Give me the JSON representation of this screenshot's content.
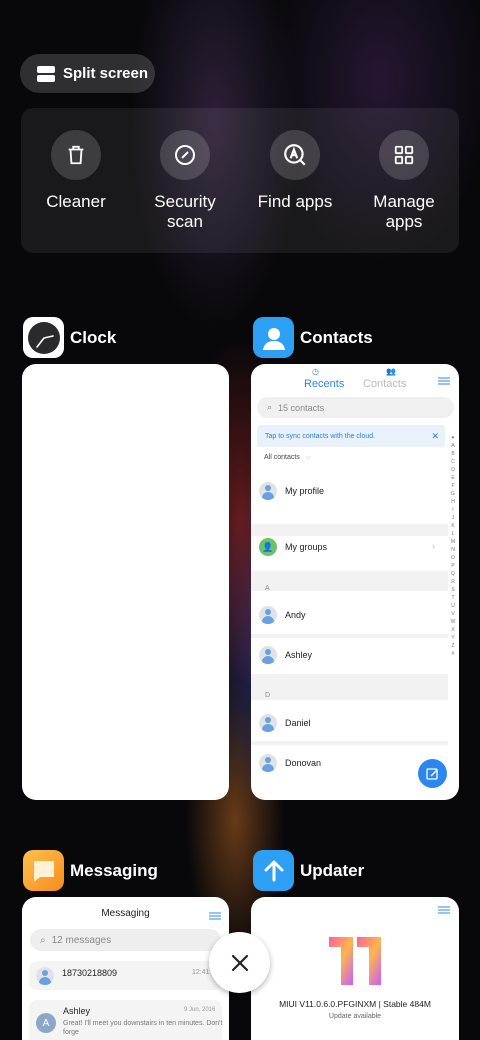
{
  "split_screen": {
    "label": "Split screen",
    "icon": "split-screen-icon"
  },
  "tools": [
    {
      "label": "Cleaner",
      "icon": "trash-icon"
    },
    {
      "label": "Security\nscan",
      "icon": "security-scan-icon"
    },
    {
      "label": "Find apps",
      "icon": "find-apps-icon"
    },
    {
      "label": "Manage\napps",
      "icon": "manage-apps-icon"
    }
  ],
  "apps": {
    "clock": {
      "name": "Clock",
      "icon": "clock-icon"
    },
    "contacts": {
      "name": "Contacts",
      "icon": "contacts-icon",
      "tab_recents": "Recents",
      "tab_contacts": "Contacts",
      "search_placeholder": "15 contacts",
      "sync_banner": "Tap to sync contacts with the cloud.",
      "filter": "All contacts",
      "my_profile": "My profile",
      "my_groups": "My groups",
      "section_a": "A",
      "section_d": "D",
      "contacts": [
        "Andy",
        "Ashley",
        "Daniel",
        "Donovan"
      ],
      "alphabet": [
        "♥",
        "A",
        "B",
        "C",
        "D",
        "E",
        "F",
        "G",
        "H",
        "I",
        "J",
        "K",
        "L",
        "M",
        "N",
        "O",
        "P",
        "Q",
        "R",
        "S",
        "T",
        "U",
        "V",
        "W",
        "X",
        "Y",
        "Z",
        "#"
      ],
      "accent_color": "#2d86ef"
    },
    "messaging": {
      "name": "Messaging",
      "icon": "messaging-icon",
      "title": "Messaging",
      "search_placeholder": "12 messages",
      "messages": [
        {
          "sender": "18730218809",
          "time": "12:41 A",
          "preview": ""
        },
        {
          "sender": "Ashley",
          "time": "9 Jun, 2016",
          "preview": "Great! I'll meet you downstairs in ten minutes. Don't forge"
        }
      ]
    },
    "updater": {
      "name": "Updater",
      "icon": "updater-icon",
      "version": "MIUI V11.0.6.0.PFGINXM | Stable 484M",
      "status": "Update available"
    }
  },
  "close_icon": "close-icon"
}
